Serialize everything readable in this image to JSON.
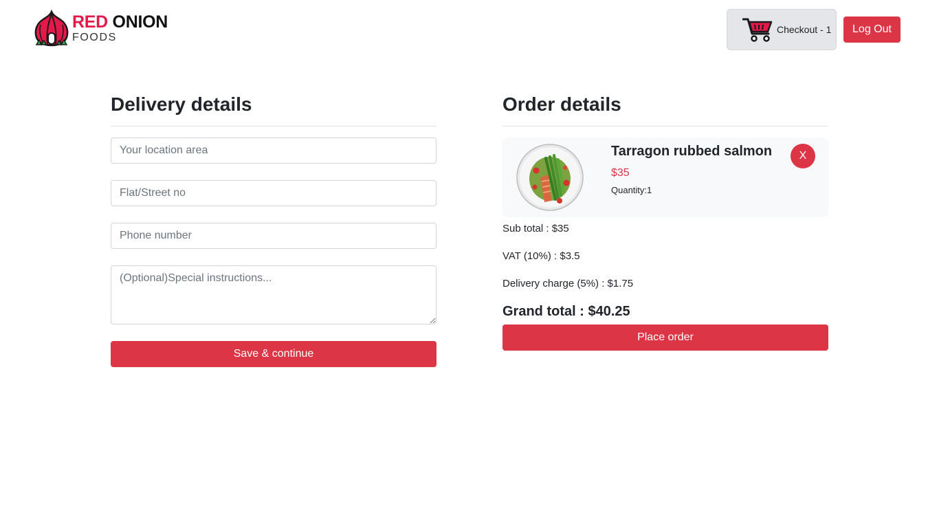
{
  "brand": {
    "name_red": "RED",
    "name_dark": "ONION",
    "subtitle": "FOODS",
    "logo_icon": "onion-logo-icon",
    "accent_color": "#dc3545"
  },
  "header": {
    "cart_label": "Checkout - 1",
    "cart_icon": "shopping-cart-icon",
    "logout_label": "Log Out"
  },
  "delivery": {
    "title": "Delivery details",
    "location_placeholder": "Your location area",
    "street_placeholder": "Flat/Street no",
    "phone_placeholder": "Phone number",
    "instructions_placeholder": "(Optional)Special instructions...",
    "submit_label": "Save & continue"
  },
  "order": {
    "title": "Order details",
    "items": [
      {
        "name": "Tarragon rubbed salmon",
        "price": "$35",
        "quantity": "Quantity:1",
        "remove_label": "X",
        "image_icon": "salmon-dish-image"
      }
    ],
    "subtotal": "Sub total : $35",
    "vat": "VAT (10%) : $3.5",
    "delivery_charge": "Delivery charge (5%) : $1.75",
    "grand_total": "Grand total : $40.25",
    "place_order_label": "Place order"
  }
}
